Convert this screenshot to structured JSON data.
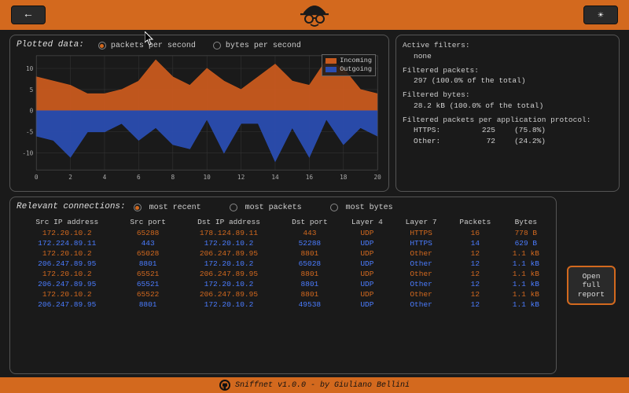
{
  "header": {
    "back_label": "←",
    "theme_label": "☀"
  },
  "plotted": {
    "title": "Plotted data:",
    "opt_packets": "packets per second",
    "opt_bytes": "bytes per second",
    "legend_in": "Incoming",
    "legend_out": "Outgoing"
  },
  "chart_data": {
    "type": "area",
    "xlabel": "",
    "ylabel": "",
    "x": [
      0,
      1,
      2,
      3,
      4,
      5,
      6,
      7,
      8,
      9,
      10,
      11,
      12,
      13,
      14,
      15,
      16,
      17,
      18,
      19,
      20
    ],
    "xticks": [
      0,
      2,
      4,
      6,
      8,
      10,
      12,
      14,
      16,
      18,
      20
    ],
    "yticks": [
      -10,
      -5,
      0,
      5,
      10
    ],
    "ylim": [
      -14,
      13
    ],
    "series": [
      {
        "name": "Incoming",
        "color": "#c85a1e",
        "values": [
          8,
          7,
          6,
          4,
          4,
          5,
          7,
          12,
          8,
          6,
          10,
          7,
          5,
          8,
          11,
          7,
          6,
          12,
          10,
          5,
          4
        ]
      },
      {
        "name": "Outgoing",
        "color": "#2a4db0",
        "values": [
          -6,
          -7,
          -11,
          -5,
          -5,
          -3,
          -7,
          -4,
          -8,
          -9,
          -2,
          -10,
          -3,
          -3,
          -12,
          -4,
          -11,
          -2,
          -8,
          -4,
          -6
        ]
      }
    ]
  },
  "filters": {
    "title_active": "Active filters:",
    "active_value": "none",
    "title_fp": "Filtered packets:",
    "fp_value": "297 (100.0% of the total)",
    "title_fb": "Filtered bytes:",
    "fb_value": "28.2 kB (100.0% of the total)",
    "title_proto": "Filtered packets per application protocol:",
    "protocols": [
      {
        "name": "HTTPS:",
        "count": "225",
        "pct": "(75.8%)"
      },
      {
        "name": "Other:",
        "count": "72",
        "pct": "(24.2%)"
      }
    ]
  },
  "connections": {
    "title": "Relevant connections:",
    "opt_recent": "most recent",
    "opt_packets": "most packets",
    "opt_bytes": "most bytes",
    "columns": [
      "Src IP address",
      "Src port",
      "Dst IP address",
      "Dst port",
      "Layer 4",
      "Layer 7",
      "Packets",
      "Bytes"
    ],
    "rows": [
      {
        "c": "orange",
        "v": [
          "172.20.10.2",
          "65288",
          "178.124.89.11",
          "443",
          "UDP",
          "HTTPS",
          "16",
          "778 B"
        ]
      },
      {
        "c": "blue",
        "v": [
          "172.224.89.11",
          "443",
          "172.20.10.2",
          "52288",
          "UDP",
          "HTTPS",
          "14",
          "629 B"
        ]
      },
      {
        "c": "orange",
        "v": [
          "172.20.10.2",
          "65028",
          "206.247.89.95",
          "8801",
          "UDP",
          "Other",
          "12",
          "1.1 kB"
        ]
      },
      {
        "c": "blue",
        "v": [
          "206.247.89.95",
          "8801",
          "172.20.10.2",
          "65028",
          "UDP",
          "Other",
          "12",
          "1.1 kB"
        ]
      },
      {
        "c": "orange",
        "v": [
          "172.20.10.2",
          "65521",
          "206.247.89.95",
          "8801",
          "UDP",
          "Other",
          "12",
          "1.1 kB"
        ]
      },
      {
        "c": "blue",
        "v": [
          "206.247.89.95",
          "65521",
          "172.20.10.2",
          "8801",
          "UDP",
          "Other",
          "12",
          "1.1 kB"
        ]
      },
      {
        "c": "orange",
        "v": [
          "172.20.10.2",
          "65522",
          "206.247.89.95",
          "8801",
          "UDP",
          "Other",
          "12",
          "1.1 kB"
        ]
      },
      {
        "c": "blue",
        "v": [
          "206.247.89.95",
          "8801",
          "172.20.10.2",
          "49538",
          "UDP",
          "Other",
          "12",
          "1.1 kB"
        ]
      }
    ]
  },
  "report_button": "Open\nfull\nreport",
  "footer": {
    "text": "Sniffnet v1.0.0 - by Giuliano Bellini"
  }
}
